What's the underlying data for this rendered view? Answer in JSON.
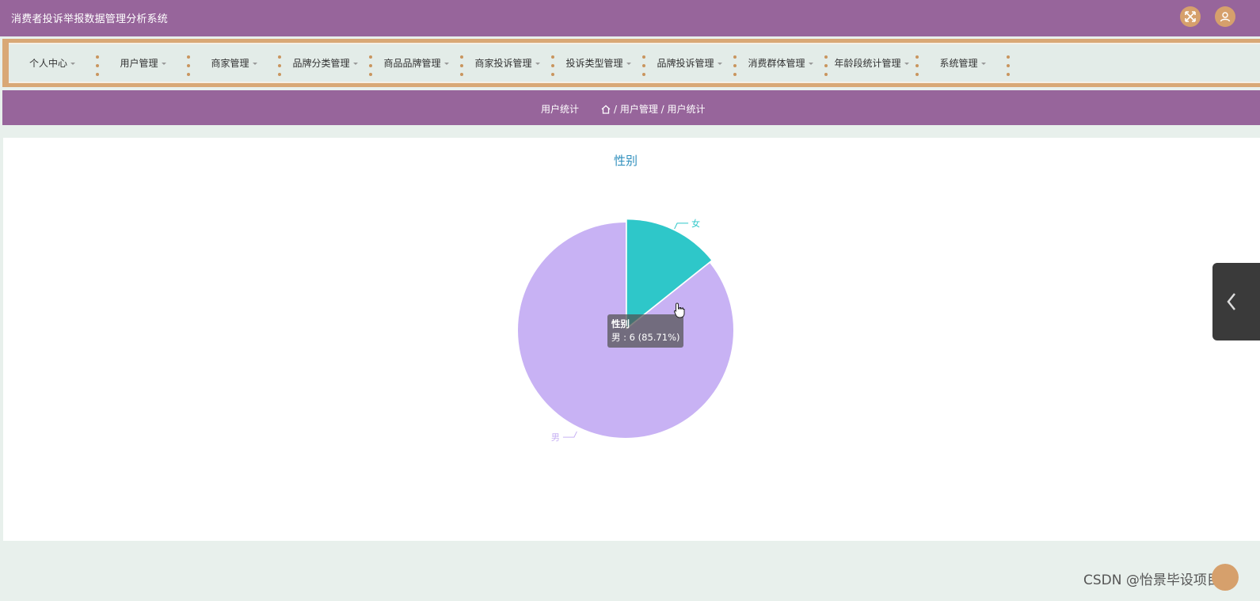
{
  "app": {
    "title": "消费者投诉举报数据管理分析系统"
  },
  "header": {
    "icons": [
      "fullscreen-icon",
      "user-icon"
    ]
  },
  "nav": {
    "items": [
      {
        "label": "个人中心"
      },
      {
        "label": "用户管理"
      },
      {
        "label": "商家管理"
      },
      {
        "label": "品牌分类管理"
      },
      {
        "label": "商品品牌管理"
      },
      {
        "label": "商家投诉管理"
      },
      {
        "label": "投诉类型管理"
      },
      {
        "label": "品牌投诉管理"
      },
      {
        "label": "消费群体管理"
      },
      {
        "label": "年龄段统计管理"
      },
      {
        "label": "系统管理"
      }
    ]
  },
  "breadcrumb": {
    "title": "用户统计",
    "path": "/ 用户管理 / 用户统计"
  },
  "chart_data": {
    "type": "pie",
    "title": "性别",
    "slices": [
      {
        "name": "女",
        "value": 1,
        "color": "#2ec7c9"
      },
      {
        "name": "男",
        "value": 6,
        "color": "#c8b2f4"
      }
    ],
    "highlighted": "男",
    "tooltip": {
      "title": "性别",
      "text": "男 : 6 (85.71%)"
    }
  },
  "watermark": "CSDN @怡景毕设项目"
}
